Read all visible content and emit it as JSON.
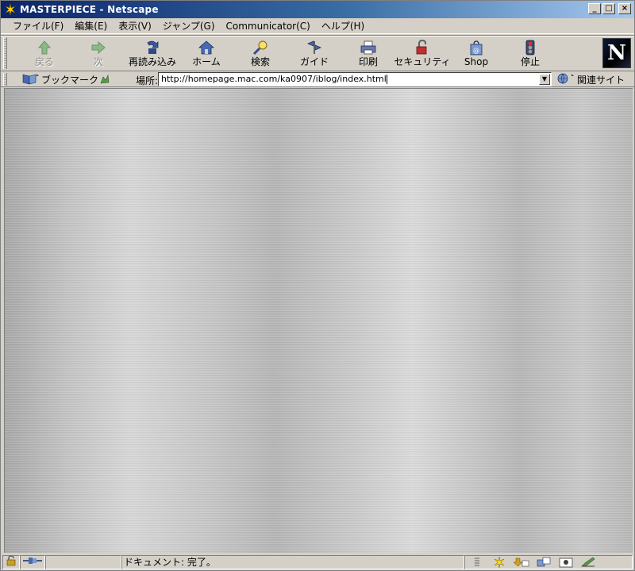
{
  "window": {
    "title": "MASTERPIECE - Netscape",
    "minimize": "_",
    "maximize": "□",
    "close": "×"
  },
  "menu": {
    "items": [
      {
        "label": "ファイル(F)"
      },
      {
        "label": "編集(E)"
      },
      {
        "label": "表示(V)"
      },
      {
        "label": "ジャンプ(G)"
      },
      {
        "label": "Communicator(C)"
      },
      {
        "label": "ヘルプ(H)"
      }
    ]
  },
  "toolbar": {
    "back": "戻る",
    "forward": "次",
    "reload": "再読み込み",
    "home": "ホーム",
    "search": "検索",
    "guide": "ガイド",
    "print": "印刷",
    "security": "セキュリティ",
    "shop": "Shop",
    "stop": "停止",
    "logo": "N"
  },
  "location": {
    "bookmarks_label": "ブックマーク",
    "location_label": "場所:",
    "url": "http://homepage.mac.com/ka0907/iblog/index.html",
    "related_label": "関連サイト"
  },
  "status": {
    "text": "ドキュメント: 完了。"
  },
  "colors": {
    "titlebar_start": "#0a246a",
    "titlebar_end": "#a6caf0",
    "chrome": "#d4d0c8",
    "content_metal": "#c4c4c4"
  }
}
